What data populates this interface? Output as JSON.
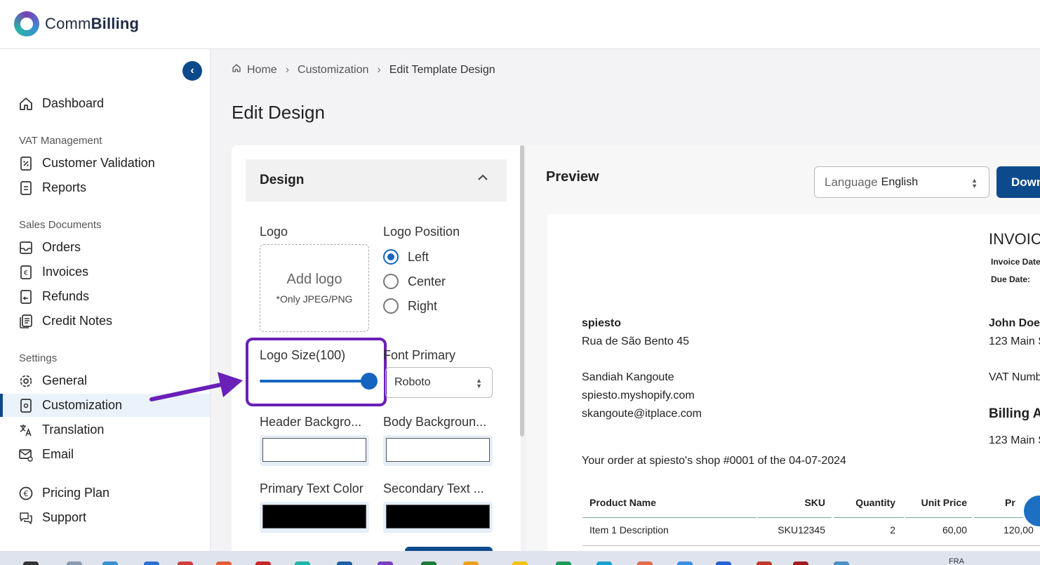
{
  "brand": {
    "name_light": "Comm",
    "name_bold": "Billing"
  },
  "sidebar": {
    "collapse_icon": "‹",
    "sections": {
      "vat": "VAT Management",
      "sales": "Sales Documents",
      "settings": "Settings"
    },
    "items": {
      "dashboard": "Dashboard",
      "customer_validation": "Customer Validation",
      "reports": "Reports",
      "orders": "Orders",
      "invoices": "Invoices",
      "refunds": "Refunds",
      "credit_notes": "Credit Notes",
      "general": "General",
      "customization": "Customization",
      "translation": "Translation",
      "email": "Email",
      "pricing_plan": "Pricing Plan",
      "support": "Support"
    },
    "active": "customization"
  },
  "breadcrumb": {
    "home": "Home",
    "customization": "Customization",
    "current": "Edit Template Design",
    "separator": "›"
  },
  "page": {
    "title": "Edit Design"
  },
  "design": {
    "section_title": "Design",
    "logo_label": "Logo",
    "add_logo": "Add logo",
    "logo_hint": "*Only JPEG/PNG",
    "logo_position_label": "Logo Position",
    "positions": [
      "Left",
      "Center",
      "Right"
    ],
    "selected_position": "Left",
    "logo_size_label": "Logo Size(100)",
    "logo_size_value": 100,
    "font_primary_label": "Font Primary",
    "font_primary_value": "Roboto",
    "header_bg_label": "Header Backgro...",
    "body_bg_label": "Body Backgroun...",
    "primary_text_label": "Primary Text Color",
    "secondary_text_label": "Secondary Text ...",
    "colors": {
      "header_bg": "#ffffff",
      "body_bg": "#ffffff",
      "primary_text": "#000000",
      "secondary_text": "#000000"
    }
  },
  "preview": {
    "title": "Preview",
    "language_label": "Language",
    "language_value": "English",
    "download_label": "Down",
    "invoice": {
      "heading": "INVOIC",
      "invoice_date_label": "Invoice Date",
      "due_date_label": "Due Date:",
      "seller_name": "spiesto",
      "seller_address": "Rua de São Bento 45",
      "contact_name": "Sandiah Kangoute",
      "shop_url": "spiesto.myshopify.com",
      "email": "skangoute@itplace.com",
      "customer_name": "John Doe",
      "customer_address": "123 Main S",
      "vat_number_label": "VAT Numb",
      "billing_heading": "Billing A",
      "billing_address": "123 Main S",
      "order_line": "Your order at spiesto's shop #0001 of the 04-07-2024",
      "table": {
        "headers": [
          "Product Name",
          "SKU",
          "Quantity",
          "Unit Price",
          "Pr"
        ],
        "rows": [
          [
            "Item 1 Description",
            "SKU12345",
            "2",
            "60,00",
            "120,00"
          ]
        ]
      }
    }
  },
  "taskbar": {
    "locale": "FRA"
  },
  "accent": {
    "primary": "#0d4a8b",
    "highlight": "#6a1fb8",
    "control": "#1565c0"
  }
}
